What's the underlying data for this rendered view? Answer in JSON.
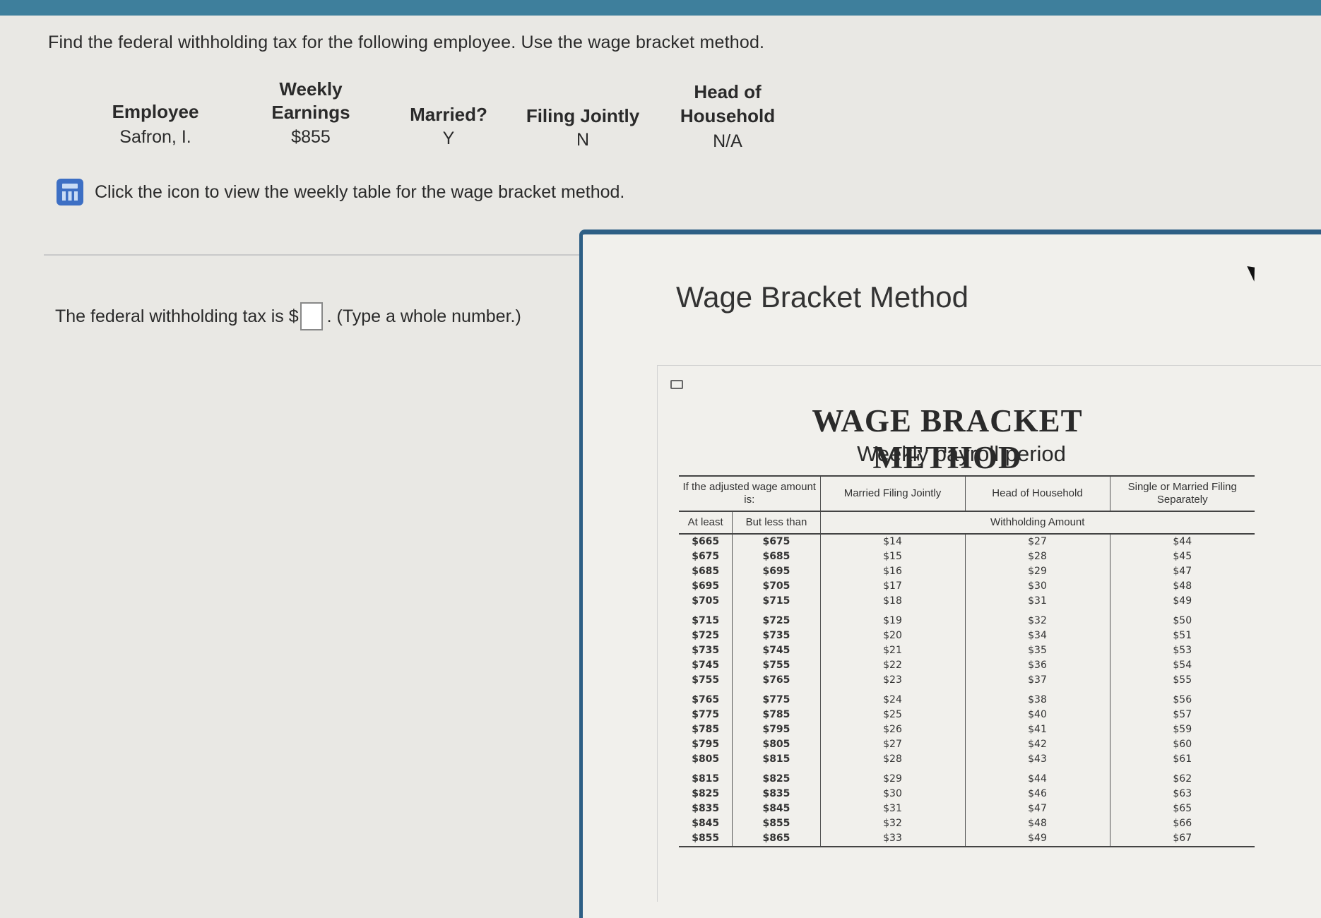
{
  "question": "Find the federal withholding tax for the following employee. Use the wage bracket method.",
  "employee_table": {
    "headers": {
      "employee": "Employee",
      "weekly_line1": "Weekly",
      "weekly_line2": "Earnings",
      "married": "Married?",
      "filing": "Filing Jointly",
      "head_line1": "Head of",
      "head_line2": "Household"
    },
    "row": {
      "employee": "Safron, I.",
      "earnings": "$855",
      "married": "Y",
      "filing": "N",
      "head": "N/A"
    }
  },
  "icon_link": {
    "icon": "calculator-icon",
    "text": "Click the icon to view the weekly table for the wage bracket method."
  },
  "answer": {
    "prefix": "The federal withholding tax is $",
    "suffix": ". (Type a whole number.)",
    "value": ""
  },
  "popup": {
    "title": "Wage Bracket Method",
    "table_title": "WAGE BRACKET METHOD",
    "table_subtitle": "Weekly payroll period",
    "headers": {
      "wage": "If the adjusted wage amount is:",
      "mfj": "Married Filing Jointly",
      "hoh": "Head of Household",
      "single": "Single or Married Filing Separately",
      "at_least": "At least",
      "but_less": "But less than",
      "withholding": "Withholding Amount"
    },
    "rows": [
      [
        "$665",
        "$675",
        "$14",
        "$27",
        "$44"
      ],
      [
        "$675",
        "$685",
        "$15",
        "$28",
        "$45"
      ],
      [
        "$685",
        "$695",
        "$16",
        "$29",
        "$47"
      ],
      [
        "$695",
        "$705",
        "$17",
        "$30",
        "$48"
      ],
      [
        "$705",
        "$715",
        "$18",
        "$31",
        "$49"
      ],
      [
        "$715",
        "$725",
        "$19",
        "$32",
        "$50"
      ],
      [
        "$725",
        "$735",
        "$20",
        "$34",
        "$51"
      ],
      [
        "$735",
        "$745",
        "$21",
        "$35",
        "$53"
      ],
      [
        "$745",
        "$755",
        "$22",
        "$36",
        "$54"
      ],
      [
        "$755",
        "$765",
        "$23",
        "$37",
        "$55"
      ],
      [
        "$765",
        "$775",
        "$24",
        "$38",
        "$56"
      ],
      [
        "$775",
        "$785",
        "$25",
        "$40",
        "$57"
      ],
      [
        "$785",
        "$795",
        "$26",
        "$41",
        "$59"
      ],
      [
        "$795",
        "$805",
        "$27",
        "$42",
        "$60"
      ],
      [
        "$805",
        "$815",
        "$28",
        "$43",
        "$61"
      ],
      [
        "$815",
        "$825",
        "$29",
        "$44",
        "$62"
      ],
      [
        "$825",
        "$835",
        "$30",
        "$46",
        "$63"
      ],
      [
        "$835",
        "$845",
        "$31",
        "$47",
        "$65"
      ],
      [
        "$845",
        "$855",
        "$32",
        "$48",
        "$66"
      ],
      [
        "$855",
        "$865",
        "$33",
        "$49",
        "$67"
      ]
    ]
  }
}
